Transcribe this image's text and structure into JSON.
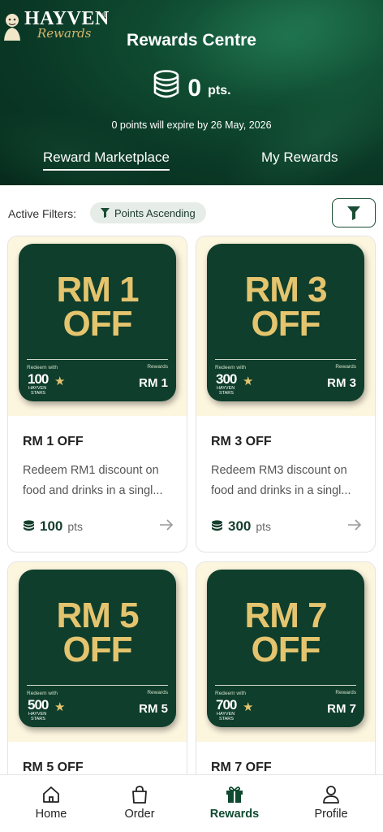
{
  "header": {
    "brand": "HAYVEN",
    "brand_sub": "Rewards",
    "brand_reg": "®",
    "title": "Rewards Centre",
    "points_value": "0",
    "points_unit": "pts.",
    "expiry_text": "0 points will expire by 26 May, 2026",
    "tabs": [
      {
        "label": "Reward Marketplace",
        "active": true
      },
      {
        "label": "My Rewards",
        "active": false
      }
    ]
  },
  "filters": {
    "label": "Active Filters:",
    "chip": "Points Ascending"
  },
  "cards": [
    {
      "big1": "RM 1",
      "big2": "OFF",
      "redeem": "Redeem with",
      "num": "100",
      "hayven": "HAYVEN",
      "stars": "STARS",
      "rewards": "Rewards",
      "rm": "RM 1",
      "title": "RM 1 OFF",
      "desc": "Redeem RM1 discount on food and drinks in a singl...",
      "points": "100",
      "unit": "pts"
    },
    {
      "big1": "RM 3",
      "big2": "OFF",
      "redeem": "Redeem with",
      "num": "300",
      "hayven": "HAYVEN",
      "stars": "STARS",
      "rewards": "Rewards",
      "rm": "RM 3",
      "title": "RM 3 OFF",
      "desc": "Redeem RM3 discount on food and drinks in a singl...",
      "points": "300",
      "unit": "pts"
    },
    {
      "big1": "RM 5",
      "big2": "OFF",
      "redeem": "Redeem with",
      "num": "500",
      "hayven": "HAYVEN",
      "stars": "STARS",
      "rewards": "Rewards",
      "rm": "RM 5",
      "title": "RM 5 OFF",
      "desc": "",
      "points": "",
      "unit": ""
    },
    {
      "big1": "RM 7",
      "big2": "OFF",
      "redeem": "Redeem with",
      "num": "700",
      "hayven": "HAYVEN",
      "stars": "STARS",
      "rewards": "Rewards",
      "rm": "RM 7",
      "title": "RM 7 OFF",
      "desc": "",
      "points": "",
      "unit": ""
    }
  ],
  "nav": [
    {
      "label": "Home",
      "icon": "home-icon",
      "active": false
    },
    {
      "label": "Order",
      "icon": "shopping-bag-icon",
      "active": false
    },
    {
      "label": "Rewards",
      "icon": "gift-icon",
      "active": true
    },
    {
      "label": "Profile",
      "icon": "user-icon",
      "active": false
    }
  ],
  "colors": {
    "brand_green": "#0f4a30",
    "gold": "#e4c46e",
    "card_bg": "#fdf6df"
  }
}
